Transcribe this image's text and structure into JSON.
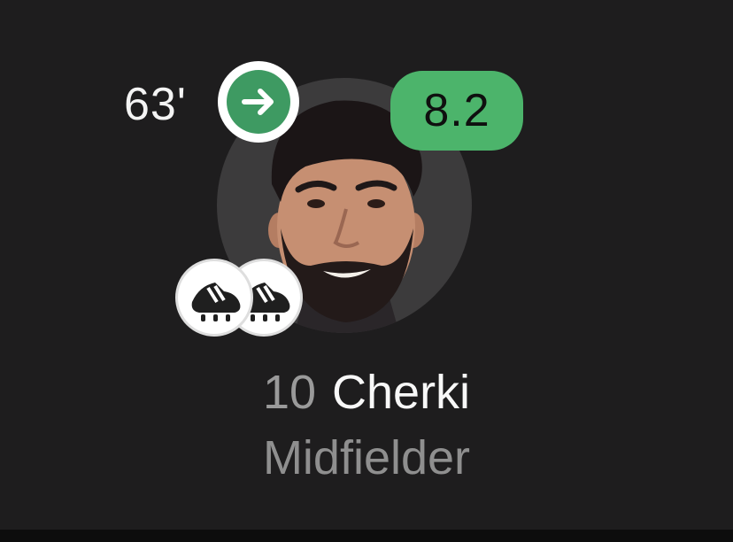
{
  "player": {
    "shirt_number": "10",
    "surname": "Cherki",
    "position": "Midfielder",
    "rating": "8.2",
    "substitution_minute": "63'",
    "substitution_icon": "arrow-right-icon",
    "goal_contribution_icons": [
      "football-boot-icon",
      "football-boot-icon"
    ]
  },
  "colors": {
    "background": "#1e1d1e",
    "rating_badge": "#4cb46b",
    "substitution_in": "#3e9a62",
    "avatar_circle": "#3c3b3c"
  }
}
